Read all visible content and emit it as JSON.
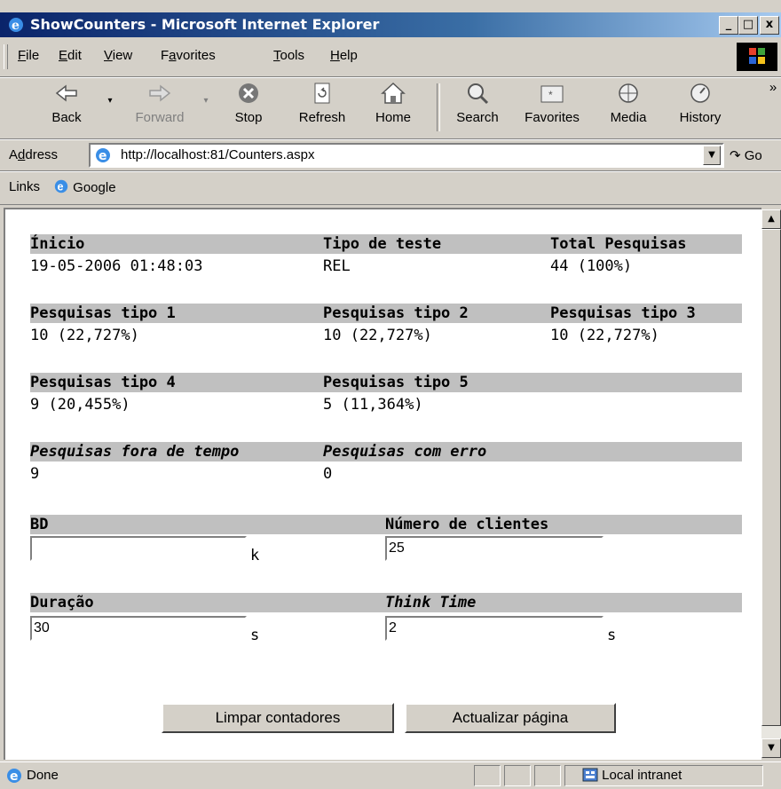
{
  "window": {
    "title": "ShowCounters - Microsoft Internet Explorer",
    "minimize": "_",
    "maximize": "□",
    "close": "x"
  },
  "menu": {
    "items": [
      {
        "key": "F",
        "rest": "ile"
      },
      {
        "key": "E",
        "rest": "dit"
      },
      {
        "key": "V",
        "rest": "iew"
      },
      {
        "pre": "F",
        "key": "a",
        "rest": "vorites"
      },
      {
        "key": "T",
        "rest": "ools"
      },
      {
        "key": "H",
        "rest": "elp"
      }
    ]
  },
  "toolbar": {
    "back": "Back",
    "forward": "Forward",
    "stop": "Stop",
    "refresh": "Refresh",
    "home": "Home",
    "search": "Search",
    "favorites": "Favorites",
    "media": "Media",
    "history": "History",
    "more": "»"
  },
  "address": {
    "label_pre": "A",
    "label_key": "d",
    "label_rest": "dress",
    "url": "http://localhost:81/Counters.aspx",
    "go": "Go"
  },
  "links": {
    "label": "Links",
    "google": "Google"
  },
  "page": {
    "row1": {
      "inicio_label": "Ínicio",
      "inicio_value": "19-05-2006 01:48:03",
      "tipo_label": "Tipo de teste",
      "tipo_value": "REL",
      "total_label": "Total Pesquisas",
      "total_value": "44 (100%)"
    },
    "row2": {
      "t1_label": "Pesquisas tipo 1",
      "t1_value": "10 (22,727%)",
      "t2_label": "Pesquisas tipo 2",
      "t2_value": "10 (22,727%)",
      "t3_label": "Pesquisas tipo 3",
      "t3_value": "10 (22,727%)"
    },
    "row3": {
      "t4_label": "Pesquisas tipo 4",
      "t4_value": "9 (20,455%)",
      "t5_label": "Pesquisas tipo 5",
      "t5_value": "5 (11,364%)"
    },
    "row4": {
      "fora_label": "Pesquisas fora de tempo",
      "fora_value": "9",
      "erro_label": "Pesquisas com erro",
      "erro_value": "0"
    },
    "form": {
      "bd_label": "BD",
      "bd_value": "",
      "bd_unit": "k",
      "clientes_label": "Número de clientes",
      "clientes_value": "25",
      "duracao_label": "Duração",
      "duracao_value": "30",
      "duracao_unit": "s",
      "think_label": "Think Time",
      "think_value": "2",
      "think_unit": "s"
    },
    "buttons": {
      "limpar": "Limpar contadores",
      "actualizar": "Actualizar página"
    }
  },
  "status": {
    "text": "Done",
    "zone": "Local intranet"
  }
}
